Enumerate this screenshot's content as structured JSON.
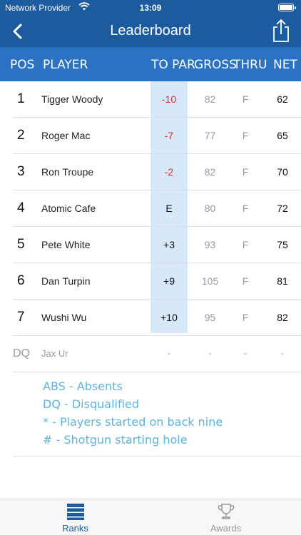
{
  "status": {
    "carrier": "Network Provider",
    "time": "13:09"
  },
  "nav": {
    "title": "Leaderboard",
    "back_icon": "chevron-left-icon",
    "share_icon": "share-icon"
  },
  "columns": {
    "pos": "POS",
    "player": "PLAYER",
    "topar": "TO PAR",
    "gross": "GROSS",
    "thru": "THRU",
    "net": "NET"
  },
  "rows": [
    {
      "pos": "1",
      "player": "Tigger Woody",
      "topar": "-10",
      "gross": "82",
      "thru": "F",
      "net": "62"
    },
    {
      "pos": "2",
      "player": "Roger Mac",
      "topar": "-7",
      "gross": "77",
      "thru": "F",
      "net": "65"
    },
    {
      "pos": "3",
      "player": "Ron Troupe",
      "topar": "-2",
      "gross": "82",
      "thru": "F",
      "net": "70"
    },
    {
      "pos": "4",
      "player": "Atomic Cafe",
      "topar": "E",
      "gross": "80",
      "thru": "F",
      "net": "72"
    },
    {
      "pos": "5",
      "player": "Pete White",
      "topar": "+3",
      "gross": "93",
      "thru": "F",
      "net": "75"
    },
    {
      "pos": "6",
      "player": "Dan Turpin",
      "topar": "+9",
      "gross": "105",
      "thru": "F",
      "net": "81"
    },
    {
      "pos": "7",
      "player": "Wushi Wu",
      "topar": "+10",
      "gross": "95",
      "thru": "F",
      "net": "82"
    },
    {
      "pos": "DQ",
      "player": "Jax Ur",
      "topar": "-",
      "gross": "-",
      "thru": "-",
      "net": "-"
    }
  ],
  "legend": [
    "ABS - Absents",
    "DQ - Disqualified",
    "* - Players started on back nine",
    "# - Shotgun starting hole"
  ],
  "tabs": {
    "ranks": "Ranks",
    "awards": "Awards"
  },
  "colors": {
    "nav": "#1d5b9f",
    "header": "#2a72c2",
    "negative": "#e0262d",
    "legend": "#5ab5e0",
    "topar_band": "#d7e8f9"
  }
}
